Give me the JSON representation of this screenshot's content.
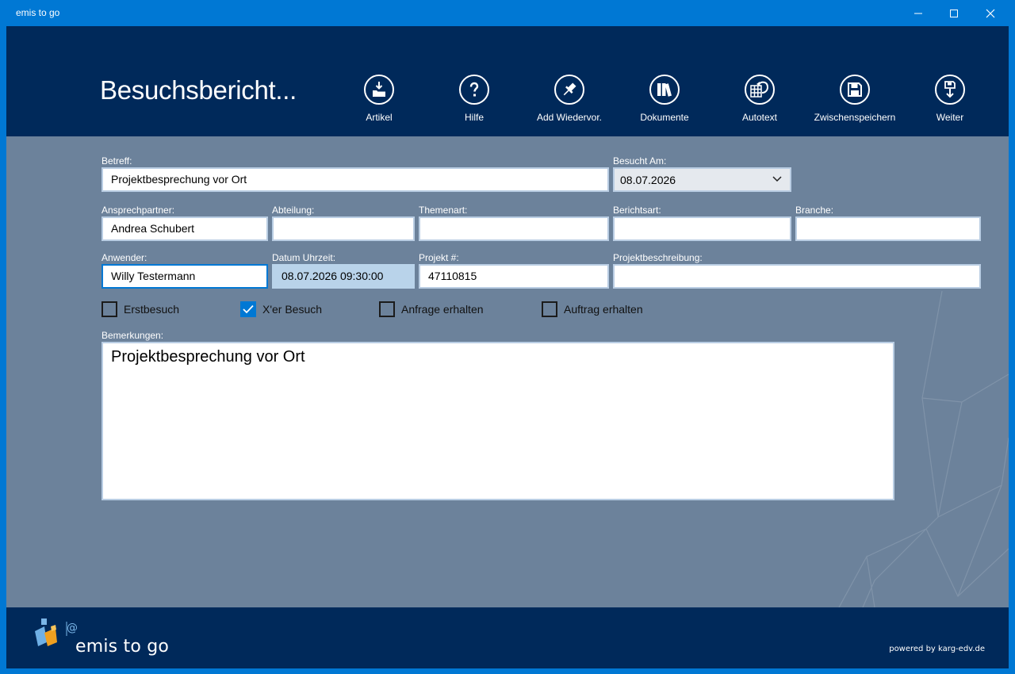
{
  "window": {
    "title": "emis to go"
  },
  "header": {
    "title": "Besuchsbericht..."
  },
  "toolbar": [
    {
      "label": "Artikel",
      "icon": "artikel-download-icon"
    },
    {
      "label": "Hilfe",
      "icon": "help-icon"
    },
    {
      "label": "Add Wiedervor.",
      "icon": "pin-icon"
    },
    {
      "label": "Dokumente",
      "icon": "books-icon"
    },
    {
      "label": "Autotext",
      "icon": "autotext-icon"
    },
    {
      "label": "Zwischenspeichern",
      "icon": "save-icon"
    },
    {
      "label": "Weiter",
      "icon": "save-next-icon"
    }
  ],
  "form": {
    "betreff": {
      "label": "Betreff:",
      "value": "Projektbesprechung vor Ort"
    },
    "besucht_am": {
      "label": "Besucht Am:",
      "value": "08.07.2026"
    },
    "ansprechpartner": {
      "label": "Ansprechpartner:",
      "value": "Andrea Schubert"
    },
    "abteilung": {
      "label": "Abteilung:",
      "value": ""
    },
    "themenart": {
      "label": "Themenart:",
      "value": ""
    },
    "berichtsart": {
      "label": "Berichtsart:",
      "value": ""
    },
    "branche": {
      "label": "Branche:",
      "value": ""
    },
    "anwender": {
      "label": "Anwender:",
      "value": "Willy Testermann"
    },
    "datum_uhrzeit": {
      "label": "Datum Uhrzeit:",
      "value": "08.07.2026 09:30:00"
    },
    "projekt_nr": {
      "label": "Projekt #:",
      "value": "47110815"
    },
    "projektbeschreibung": {
      "label": "Projektbeschreibung:",
      "value": ""
    },
    "checkboxes": [
      {
        "label": "Erstbesuch",
        "checked": false
      },
      {
        "label": "X'er Besuch",
        "checked": true
      },
      {
        "label": "Anfrage erhalten",
        "checked": false
      },
      {
        "label": "Auftrag erhalten",
        "checked": false
      }
    ],
    "bemerkungen": {
      "label": "Bemerkungen:",
      "value": "Projektbesprechung vor Ort"
    }
  },
  "footer": {
    "logo_text": "emis to go",
    "powered": "powered by karg-edv.de"
  },
  "colors": {
    "accent": "#0078d4",
    "header_bg": "#00295a",
    "content_bg": "#6c829b"
  }
}
